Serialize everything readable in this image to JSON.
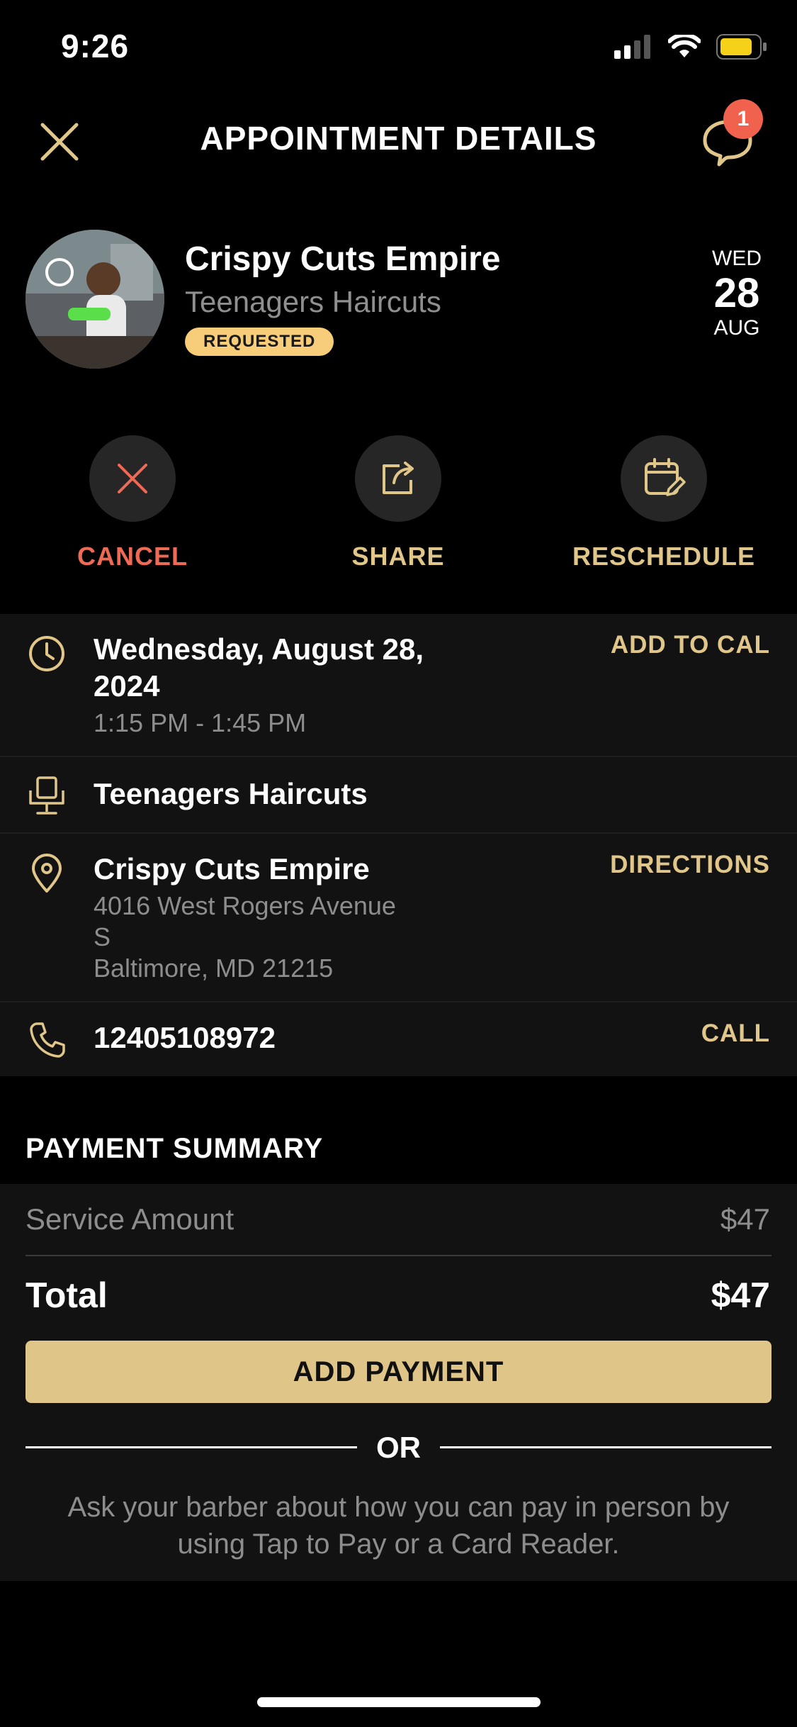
{
  "status_bar": {
    "time": "9:26",
    "icons": [
      "signal-icon",
      "wifi-icon",
      "battery-icon"
    ]
  },
  "header": {
    "title": "APPOINTMENT DETAILS",
    "close_icon": "close-icon",
    "chat_icon": "chat-icon",
    "chat_badge": "1"
  },
  "shop": {
    "name": "Crispy Cuts Empire",
    "service": "Teenagers Haircuts",
    "status": "REQUESTED",
    "date": {
      "dow": "WED",
      "day": "28",
      "month": "AUG"
    }
  },
  "actions": [
    {
      "label": "CANCEL",
      "icon": "x-icon",
      "color": "#ef6a55"
    },
    {
      "label": "SHARE",
      "icon": "share-icon",
      "color": "#e0c689"
    },
    {
      "label": "RESCHEDULE",
      "icon": "calendar-edit-icon",
      "color": "#e0c689"
    }
  ],
  "details": {
    "datetime": {
      "title": "Wednesday, August 28, 2024",
      "time": "1:15 PM - 1:45 PM",
      "action": "ADD TO CAL",
      "icon": "clock-icon"
    },
    "service": {
      "title": "Teenagers Haircuts",
      "icon": "barber-chair-icon"
    },
    "location": {
      "title": "Crispy Cuts Empire",
      "address_line1": "4016 West Rogers Avenue",
      "address_line2": "S",
      "address_line3": "Baltimore, MD 21215",
      "action": "DIRECTIONS",
      "icon": "map-pin-icon"
    },
    "phone": {
      "number": "12405108972",
      "action": "CALL",
      "icon": "phone-icon"
    }
  },
  "payment": {
    "title": "PAYMENT SUMMARY",
    "service_label": "Service Amount",
    "service_amount": "$47",
    "total_label": "Total",
    "total_amount": "$47",
    "button": "ADD PAYMENT",
    "or": "OR",
    "note": "Ask your barber about how you can pay in person by using Tap to Pay or a Card Reader."
  },
  "colors": {
    "accent": "#e0c689",
    "cancel": "#ef6a55",
    "badge": "#f8cd7a",
    "panel": "#121212"
  }
}
